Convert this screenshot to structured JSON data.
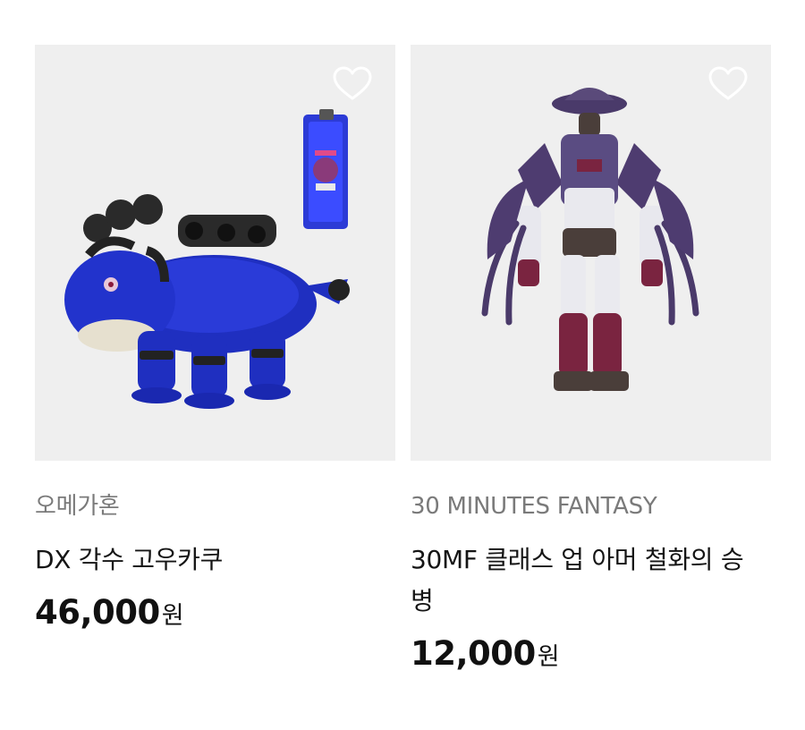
{
  "products": [
    {
      "brand": "오메가혼",
      "name": "DX 각수 고우카쿠",
      "price": "46,000",
      "currency": "원",
      "image_icon": "blue-beast-figure-icon",
      "wishlist_icon": "heart-outline-icon"
    },
    {
      "brand": "30 MINUTES FANTASY",
      "name": "30MF 클래스 업 아머 철화의 승병",
      "price": "12,000",
      "currency": "원",
      "image_icon": "armored-warrior-figure-icon",
      "wishlist_icon": "heart-outline-icon"
    }
  ],
  "colors": {
    "thumb_bg": "#efefef",
    "brand_text": "#7a7a7a",
    "price_text": "#111111"
  }
}
